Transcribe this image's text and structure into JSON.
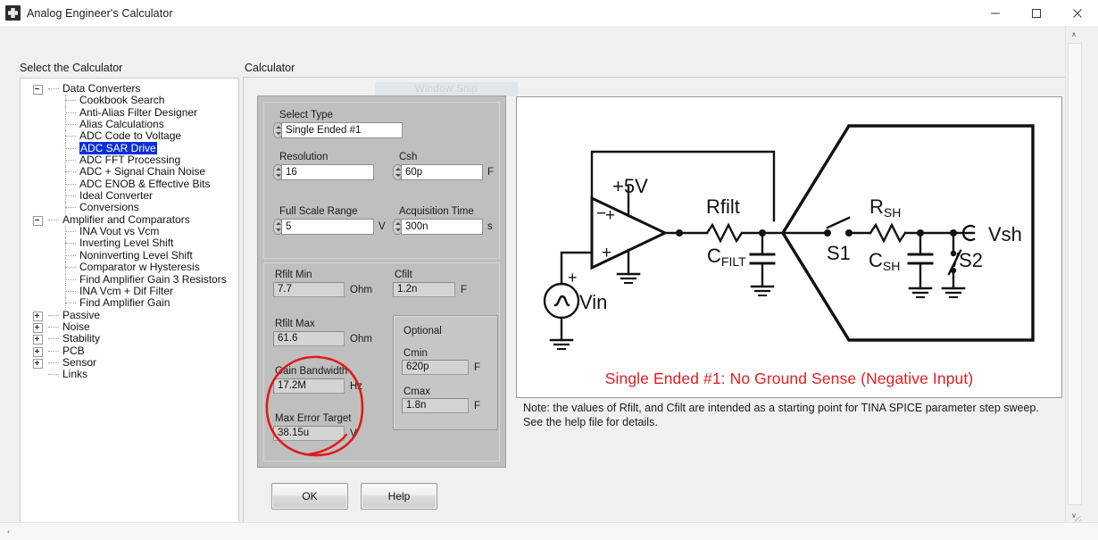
{
  "window": {
    "title": "Analog Engineer's Calculator",
    "icon": "app-icon",
    "minimize_label": "—",
    "maximize_label": "□",
    "close_label": "✕"
  },
  "watermark": "Window Snip",
  "left_panel": {
    "label": "Select the Calculator",
    "tree": [
      {
        "label": "Data Converters",
        "level": 0,
        "expander": "minus",
        "selected": false
      },
      {
        "label": "Cookbook Search",
        "level": 1,
        "expander": "none",
        "selected": false
      },
      {
        "label": "Anti-Alias Filter Designer",
        "level": 1,
        "expander": "none",
        "selected": false
      },
      {
        "label": "Alias Calculations",
        "level": 1,
        "expander": "none",
        "selected": false
      },
      {
        "label": "ADC Code to Voltage",
        "level": 1,
        "expander": "none",
        "selected": false
      },
      {
        "label": "ADC SAR Drive",
        "level": 1,
        "expander": "none",
        "selected": true
      },
      {
        "label": "ADC FFT Processing",
        "level": 1,
        "expander": "none",
        "selected": false
      },
      {
        "label": "ADC + Signal Chain Noise",
        "level": 1,
        "expander": "none",
        "selected": false
      },
      {
        "label": "ADC ENOB & Effective Bits",
        "level": 1,
        "expander": "none",
        "selected": false
      },
      {
        "label": "Ideal Converter",
        "level": 1,
        "expander": "none",
        "selected": false
      },
      {
        "label": "Conversions",
        "level": 1,
        "expander": "none",
        "selected": false
      },
      {
        "label": "Amplifier and Comparators",
        "level": 0,
        "expander": "minus",
        "selected": false
      },
      {
        "label": "INA Vout vs Vcm",
        "level": 1,
        "expander": "none",
        "selected": false
      },
      {
        "label": "Inverting Level Shift",
        "level": 1,
        "expander": "none",
        "selected": false
      },
      {
        "label": "Noninverting Level Shift",
        "level": 1,
        "expander": "none",
        "selected": false
      },
      {
        "label": "Comparator w Hysteresis",
        "level": 1,
        "expander": "none",
        "selected": false
      },
      {
        "label": "Find Amplifier Gain 3 Resistors",
        "level": 1,
        "expander": "none",
        "selected": false
      },
      {
        "label": "INA Vcm + Dif Filter",
        "level": 1,
        "expander": "none",
        "selected": false
      },
      {
        "label": "Find Amplifier Gain",
        "level": 1,
        "expander": "none",
        "selected": false
      },
      {
        "label": "Passive",
        "level": 0,
        "expander": "plus",
        "selected": false
      },
      {
        "label": "Noise",
        "level": 0,
        "expander": "plus",
        "selected": false
      },
      {
        "label": "Stability",
        "level": 0,
        "expander": "plus",
        "selected": false
      },
      {
        "label": "PCB",
        "level": 0,
        "expander": "plus",
        "selected": false
      },
      {
        "label": "Sensor",
        "level": 0,
        "expander": "plus",
        "selected": false
      },
      {
        "label": "Links",
        "level": 0,
        "expander": "none",
        "selected": false
      }
    ]
  },
  "right_panel": {
    "label": "Calculator",
    "inputs": {
      "select_type": {
        "label": "Select Type",
        "value": "Single Ended #1",
        "unit": ""
      },
      "resolution": {
        "label": "Resolution",
        "value": "16",
        "unit": ""
      },
      "csh": {
        "label": "Csh",
        "value": "60p",
        "unit": "F"
      },
      "full_scale_range": {
        "label": "Full Scale Range",
        "value": "5",
        "unit": "V"
      },
      "acquisition_time": {
        "label": "Acquisition Time",
        "value": "300n",
        "unit": "s"
      }
    },
    "outputs": {
      "rfilt_min": {
        "label": "Rfilt Min",
        "value": "7.7",
        "unit": "Ohm"
      },
      "cfilt": {
        "label": "Cfilt",
        "value": "1.2n",
        "unit": "F"
      },
      "rfilt_max": {
        "label": "Rfilt Max",
        "value": "61.6",
        "unit": "Ohm"
      },
      "gain_bandwidth": {
        "label": "Gain Bandwidth",
        "value": "17.2M",
        "unit": "Hz"
      },
      "max_error_target": {
        "label": "Max Error Target",
        "value": "38.15u",
        "unit": "V"
      }
    },
    "optional": {
      "title": "Optional",
      "cmin": {
        "label": "Cmin",
        "value": "620p",
        "unit": "F"
      },
      "cmax": {
        "label": "Cmax",
        "value": "1.8n",
        "unit": "F"
      }
    },
    "buttons": {
      "ok": "OK",
      "help": "Help"
    }
  },
  "schematic": {
    "caption": "Single Ended #1: No Ground Sense (Negative Input)",
    "caption_color": "#e02020",
    "labels": {
      "supply": "+5V",
      "vin": "Vin",
      "rfilt": "Rfilt",
      "cfilt_base": "C",
      "cfilt_sub": "FILT",
      "s1": "S1",
      "rsh_base": "R",
      "rsh_sub": "SH",
      "csh_base": "C",
      "csh_sub": "SH",
      "s2": "/S2",
      "vsh": "Vsh",
      "opamp_minus": "−",
      "opamp_plus": "+",
      "src_plus": "+"
    }
  },
  "note": "Note: the values of Rfilt, and Cfilt are intended as a starting point for TINA SPICE parameter step sweep.  See the help file for details.",
  "annotation": {
    "ink_color": "#e01a1a",
    "shape": "hand-drawn-circle"
  },
  "scrollbars": {
    "v_up": "∧",
    "v_down": "∨",
    "h_left": "‹"
  }
}
